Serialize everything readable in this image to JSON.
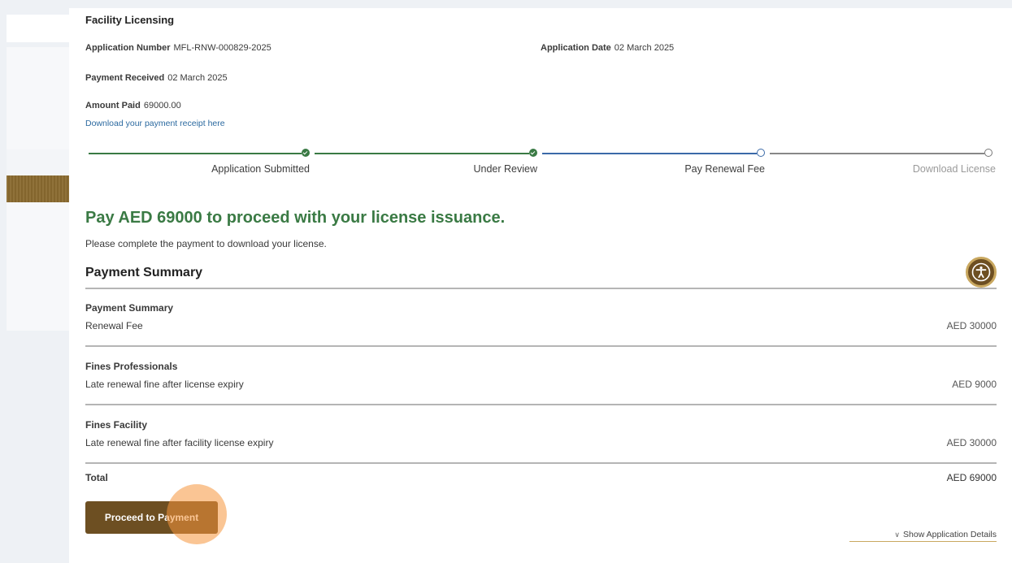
{
  "header": {
    "section_title": "Facility Licensing",
    "application_number_label": "Application Number",
    "application_number": "MFL-RNW-000829-2025",
    "application_date_label": "Application Date",
    "application_date": "02 March 2025",
    "payment_received_label": "Payment Received",
    "payment_received": "02 March 2025",
    "amount_paid_label": "Amount Paid",
    "amount_paid": "69000.00",
    "receipt_link": "Download your payment receipt here"
  },
  "progress": {
    "steps": [
      {
        "label": "Application Submitted",
        "status": "done"
      },
      {
        "label": "Under Review",
        "status": "done"
      },
      {
        "label": "Pay Renewal Fee",
        "status": "current"
      },
      {
        "label": "Download License",
        "status": "todo"
      }
    ]
  },
  "main": {
    "headline": "Pay AED 69000 to proceed with your license issuance.",
    "instruction": "Please complete the payment to download your license.",
    "summary_title": "Payment Summary"
  },
  "summary": {
    "items": [
      {
        "title": "Payment Summary",
        "description": "Renewal Fee",
        "amount": "AED 30000"
      },
      {
        "title": "Fines Professionals",
        "description": "Late renewal fine after license expiry",
        "amount": "AED 9000"
      },
      {
        "title": "Fines Facility",
        "description": "Late renewal fine after facility license expiry",
        "amount": "AED 30000"
      }
    ],
    "total_label": "Total",
    "total_amount": "AED 69000"
  },
  "actions": {
    "proceed_label": "Proceed to Payment",
    "show_details_label": "Show Application Details"
  },
  "colors": {
    "brand_brown": "#6d4f22",
    "success_green": "#3a7a44",
    "current_blue": "#3b6aa8",
    "accessibility_icon": "accessibility-icon"
  }
}
